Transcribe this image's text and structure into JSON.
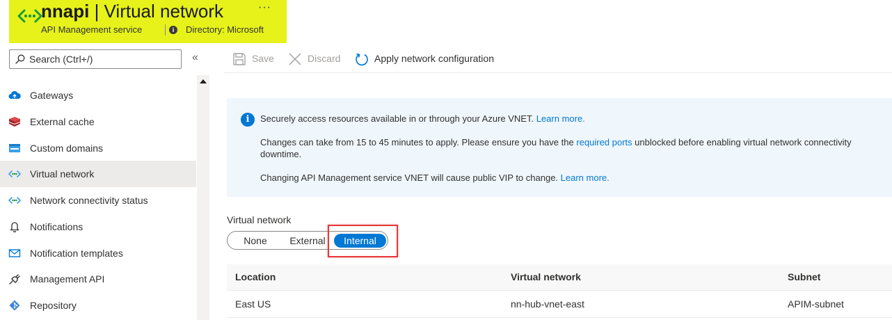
{
  "header": {
    "name": "nnapi",
    "separator": " | ",
    "page": "Virtual network",
    "more": "···",
    "subtitle": "API Management service",
    "directory": "Directory: Microsoft",
    "highlight_color": "#e6f21a"
  },
  "search": {
    "placeholder": "Search (Ctrl+/)",
    "collapse": "«"
  },
  "sidebar": {
    "items": [
      {
        "label": "Gateways",
        "icon": "cloud-icon"
      },
      {
        "label": "External cache",
        "icon": "cache-icon"
      },
      {
        "label": "Custom domains",
        "icon": "www-icon"
      },
      {
        "label": "Virtual network",
        "icon": "vnet-icon",
        "selected": true
      },
      {
        "label": "Network connectivity status",
        "icon": "vnet-icon"
      },
      {
        "label": "Notifications",
        "icon": "bell-icon"
      },
      {
        "label": "Notification templates",
        "icon": "mail-icon"
      },
      {
        "label": "Management API",
        "icon": "plug-icon"
      },
      {
        "label": "Repository",
        "icon": "git-icon"
      }
    ]
  },
  "toolbar": {
    "save": "Save",
    "discard": "Discard",
    "apply": "Apply network configuration"
  },
  "banner": {
    "line1_text": "Securely access resources available in or through your Azure VNET. ",
    "line1_link": "Learn more.",
    "line2_text_a": "Changes can take from 15 to 45 minutes to apply. Please ensure you have the ",
    "line2_link": "required ports",
    "line2_text_b": " unblocked before enabling virtual network connectivity",
    "line3_text": "downtime.",
    "line4_text": "Changing API Management service VNET will cause public VIP to change. ",
    "line4_link": "Learn more."
  },
  "vnet": {
    "label": "Virtual network",
    "options": [
      "None",
      "External",
      "Internal"
    ],
    "selected": "Internal",
    "accent": "#0078d4",
    "callout_color": "#e5383b"
  },
  "table": {
    "columns": [
      "Location",
      "Virtual network",
      "Subnet"
    ],
    "rows": [
      [
        "East US",
        "nn-hub-vnet-east",
        "APIM-subnet"
      ]
    ]
  }
}
